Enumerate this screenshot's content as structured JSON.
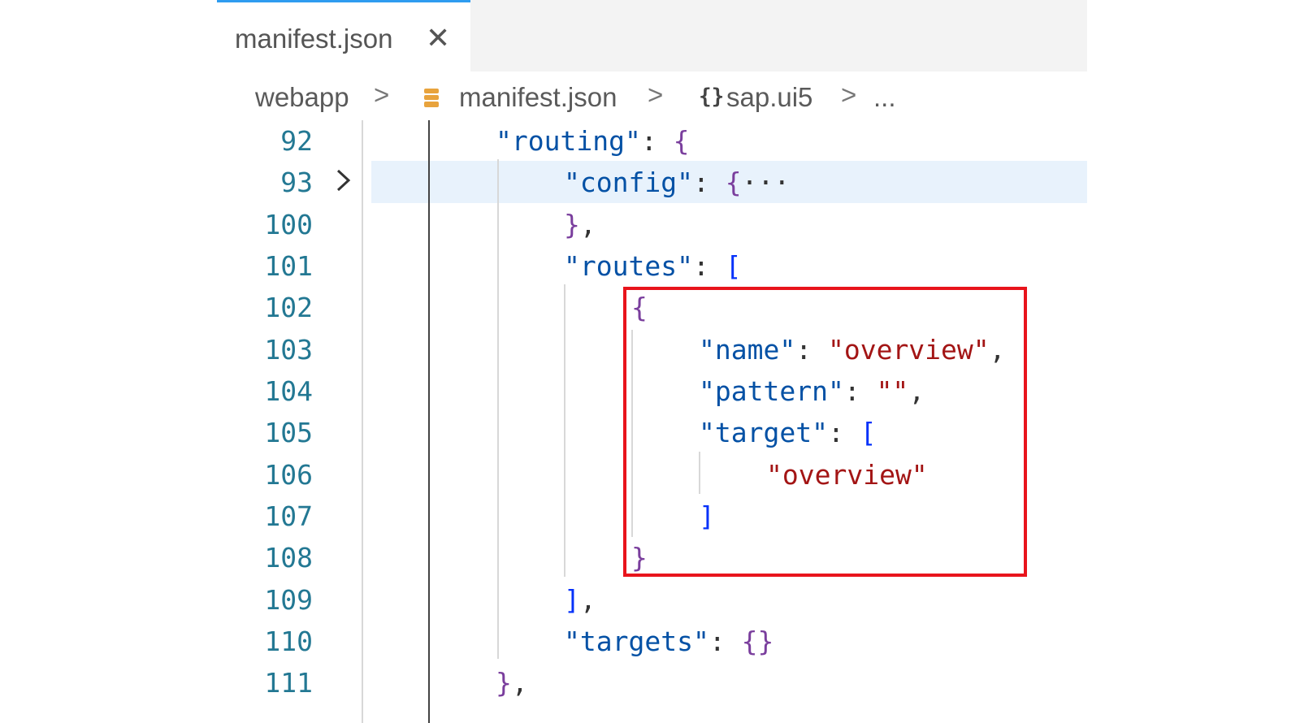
{
  "tab": {
    "label": "manifest.json",
    "close_glyph": "✕"
  },
  "breadcrumb": {
    "items": [
      "webapp",
      "manifest.json",
      "sap.ui5",
      "..."
    ],
    "separator": ">",
    "file_icon": "json-file-icon",
    "object_icon": "braces-icon"
  },
  "colors": {
    "key": "#0451a5",
    "string": "#a31515",
    "line_number": "#237893",
    "highlight_border": "#e8141c",
    "active_tab_accent": "#2e9cf0"
  },
  "code": {
    "lines": [
      {
        "num": "92",
        "text": "\"routing\": {"
      },
      {
        "num": "93",
        "text": "\"config\": {···",
        "folded": true
      },
      {
        "num": "100",
        "text": "},"
      },
      {
        "num": "101",
        "text": "\"routes\": ["
      },
      {
        "num": "102",
        "text": "{"
      },
      {
        "num": "103",
        "text": "\"name\": \"overview\","
      },
      {
        "num": "104",
        "text": "\"pattern\": \"\","
      },
      {
        "num": "105",
        "text": "\"target\": ["
      },
      {
        "num": "106",
        "text": "\"overview\""
      },
      {
        "num": "107",
        "text": "]"
      },
      {
        "num": "108",
        "text": "}"
      },
      {
        "num": "109",
        "text": "],"
      },
      {
        "num": "110",
        "text": "\"targets\": {}"
      },
      {
        "num": "111",
        "text": "},"
      }
    ]
  }
}
